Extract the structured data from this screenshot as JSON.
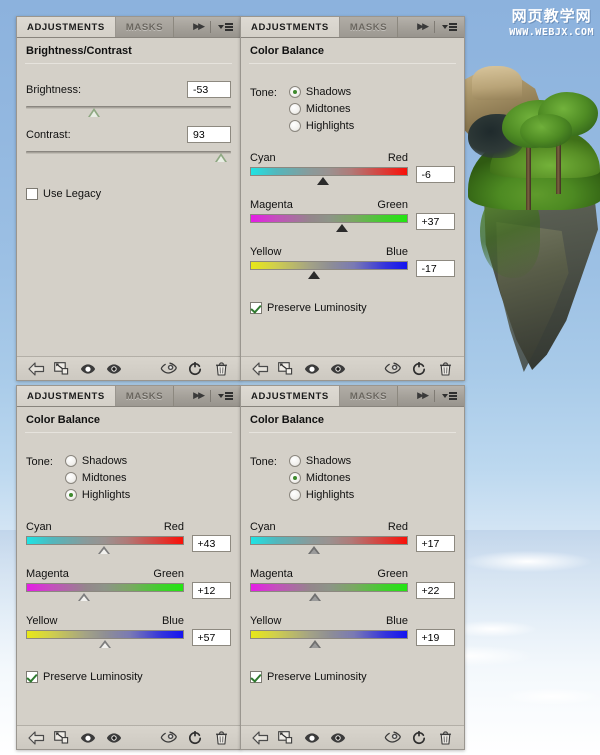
{
  "watermark": {
    "cn": "网页教学网",
    "url": "WWW.WEBJX.COM"
  },
  "tabs": {
    "adjustments": "ADJUSTMENTS",
    "masks": "MASKS",
    "expand_icon": "double-chevron-right-icon",
    "menu_icon": "panel-menu-icon"
  },
  "footer_icons": [
    {
      "name": "return-to-adjustment-list-icon",
      "label": "Return to adjustment list"
    },
    {
      "name": "clip-to-layer-icon",
      "label": "Clip to layer"
    },
    {
      "name": "toggle-layer-visibility-icon",
      "label": "Toggle layer visibility"
    },
    {
      "name": "preview-eye-icon",
      "label": "View previous state"
    },
    {
      "name": "reset-eye-icon",
      "label": "Press to view previous state"
    },
    {
      "name": "reset-adjustment-icon",
      "label": "Reset to adjustment defaults"
    },
    {
      "name": "delete-adjustment-icon",
      "label": "Delete this adjustment layer"
    }
  ],
  "panels": [
    {
      "id": "panel-1",
      "title": "Brightness/Contrast",
      "type": "brightness_contrast",
      "controls": [
        {
          "label": "Brightness:",
          "value": "-53",
          "percent": 33
        },
        {
          "label": "Contrast:",
          "value": "93",
          "percent": 95
        }
      ],
      "checkbox": {
        "label": "Use Legacy",
        "checked": false
      }
    },
    {
      "id": "panel-2",
      "title": "Color Balance",
      "type": "color_balance",
      "tone_label": "Tone:",
      "tone_options": [
        "Shadows",
        "Midtones",
        "Highlights"
      ],
      "tone_selected": "Shadows",
      "sliders": [
        {
          "left": "Cyan",
          "right": "Red",
          "value": "-6",
          "percent": 47,
          "handle": "dark"
        },
        {
          "left": "Magenta",
          "right": "Green",
          "value": "+37",
          "percent": 59,
          "handle": "dark"
        },
        {
          "left": "Yellow",
          "right": "Blue",
          "value": "-17",
          "percent": 41,
          "handle": "dark"
        }
      ],
      "checkbox": {
        "label": "Preserve Luminosity",
        "checked": true
      }
    },
    {
      "id": "panel-3",
      "title": "Color Balance",
      "type": "color_balance",
      "tone_label": "Tone:",
      "tone_options": [
        "Shadows",
        "Midtones",
        "Highlights"
      ],
      "tone_selected": "Highlights",
      "sliders": [
        {
          "left": "Cyan",
          "right": "Red",
          "value": "+43",
          "percent": 50,
          "handle": "light"
        },
        {
          "left": "Magenta",
          "right": "Green",
          "value": "+12",
          "percent": 37,
          "handle": "light"
        },
        {
          "left": "Yellow",
          "right": "Blue",
          "value": "+57",
          "percent": 51,
          "handle": "light"
        }
      ],
      "checkbox": {
        "label": "Preserve Luminosity",
        "checked": true
      }
    },
    {
      "id": "panel-4",
      "title": "Color Balance",
      "type": "color_balance",
      "tone_label": "Tone:",
      "tone_options": [
        "Shadows",
        "Midtones",
        "Highlights"
      ],
      "tone_selected": "Midtones",
      "sliders": [
        {
          "left": "Cyan",
          "right": "Red",
          "value": "+17",
          "percent": 41,
          "handle": "gray"
        },
        {
          "left": "Magenta",
          "right": "Green",
          "value": "+22",
          "percent": 42,
          "handle": "gray"
        },
        {
          "left": "Yellow",
          "right": "Blue",
          "value": "+19",
          "percent": 42,
          "handle": "gray"
        }
      ],
      "checkbox": {
        "label": "Preserve Luminosity",
        "checked": true
      }
    }
  ],
  "colors": {
    "panel_bg": "#d4d0c8",
    "tab_active": "#d4d0c8",
    "tab_inactive": "#a5a19a",
    "check_green": "#2f7a2f",
    "radio_green": "#3f8a2e",
    "sky": "#8cb2dd"
  }
}
